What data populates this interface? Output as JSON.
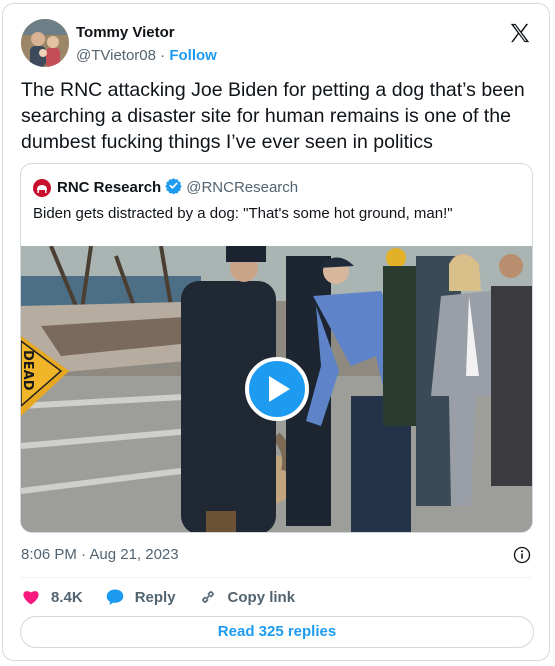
{
  "author": {
    "name": "Tommy Vietor",
    "handle": "@TVietor08",
    "separator": "·",
    "follow_label": "Follow"
  },
  "tweet": {
    "text": "The RNC attacking Joe Biden for petting a dog that’s been searching a disaster site for human remains is one of the dumbest fucking things I’ve ever seen in politics",
    "timestamp": "8:06 PM · Aug 21, 2023"
  },
  "quoted_tweet": {
    "author_name": "RNC Research",
    "author_handle": "@RNCResearch",
    "verified": true,
    "text": "Biden gets distracted by a dog: \"That's some hot ground, man!\"",
    "media_type": "video",
    "sign_text": "DEAD"
  },
  "actions": {
    "likes": "8.4K",
    "reply_label": "Reply",
    "copy_label": "Copy link"
  },
  "read_replies_label": "Read 325 replies",
  "colors": {
    "accent": "#1d9bf0",
    "like": "#f91880",
    "text": "#0f1419",
    "secondary": "#536471",
    "border": "#cfd9de"
  },
  "icons": [
    "x-logo-icon",
    "verified-badge-icon",
    "play-icon",
    "info-icon",
    "heart-icon",
    "reply-bubble-icon",
    "link-icon"
  ]
}
